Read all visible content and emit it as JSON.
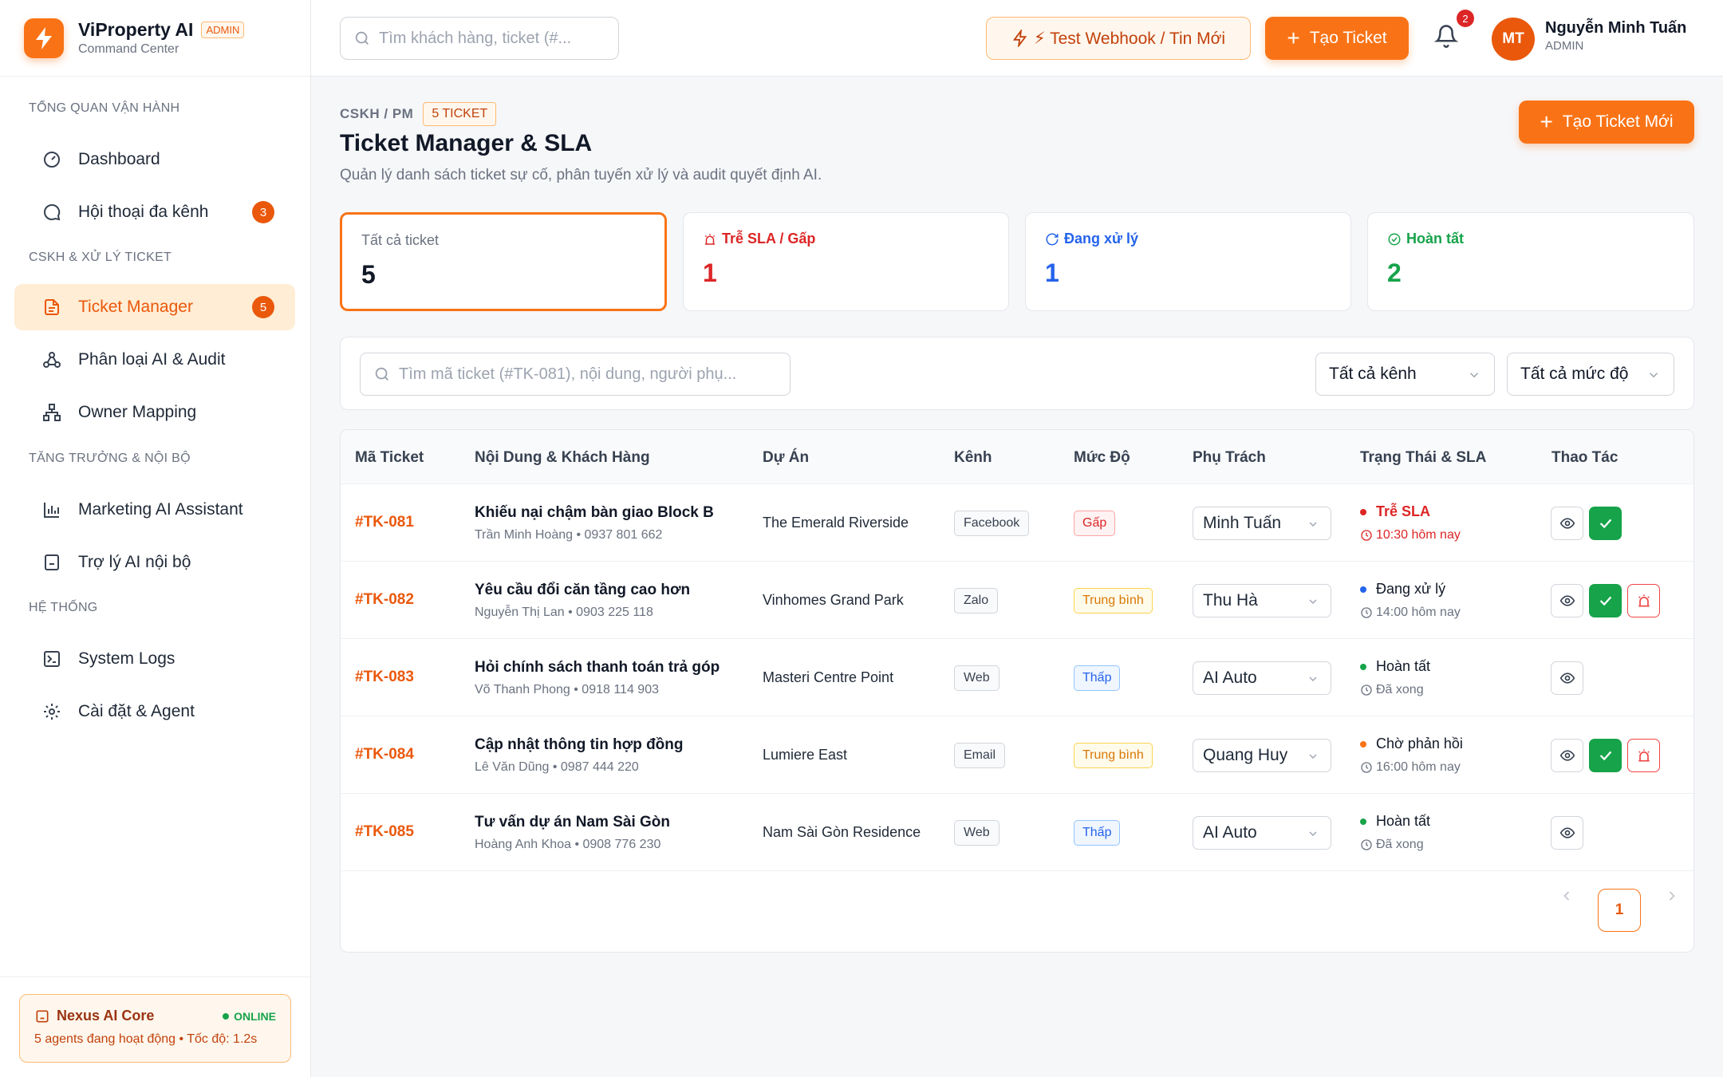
{
  "brand": {
    "title": "ViProperty AI",
    "tag": "ADMIN",
    "subtitle": "Command Center"
  },
  "sidebar": {
    "sections": [
      {
        "label": "TỔNG QUAN VẬN HÀNH"
      },
      {
        "label": "CSKH & XỬ LÝ TICKET"
      },
      {
        "label": "TĂNG TRƯỞNG & NỘI BỘ"
      },
      {
        "label": "HỆ THỐNG"
      }
    ],
    "items": [
      {
        "label": "Dashboard",
        "icon": "gauge-icon"
      },
      {
        "label": "Hội thoại đa kênh",
        "icon": "chat-icon",
        "badge": "3"
      },
      {
        "label": "Ticket Manager",
        "icon": "document-icon",
        "badge": "5",
        "active": true
      },
      {
        "label": "Phân loại AI & Audit",
        "icon": "network-icon"
      },
      {
        "label": "Owner Mapping",
        "icon": "org-chart-icon"
      },
      {
        "label": "Marketing AI Assistant",
        "icon": "bar-chart-icon"
      },
      {
        "label": "Trợ lý AI nội bộ",
        "icon": "bot-icon"
      },
      {
        "label": "System Logs",
        "icon": "terminal-icon"
      },
      {
        "label": "Cài đặt & Agent",
        "icon": "gear-icon"
      }
    ],
    "core": {
      "title": "Nexus AI Core",
      "status": "ONLINE",
      "subtitle": "5 agents đang hoạt động • Tốc độ: 1.2s"
    }
  },
  "topbar": {
    "search_placeholder": "Tìm khách hàng, ticket (#...",
    "webhook_label": "⚡ Test Webhook / Tin Mới",
    "create_label": "Tạo Ticket",
    "notifications": "2",
    "user": {
      "initials": "MT",
      "name": "Nguyễn Minh Tuấn",
      "role": "ADMIN"
    }
  },
  "page": {
    "crumb": "CSKH / PM",
    "count_badge": "5 TICKET",
    "title": "Ticket Manager & SLA",
    "description": "Quản lý danh sách ticket sự cố, phân tuyến xử lý và audit quyết định AI.",
    "new_button": "Tạo Ticket Mới"
  },
  "stats": [
    {
      "label": "Tất cả ticket",
      "value": "5",
      "color": "#111827"
    },
    {
      "label": "Trễ SLA / Gấp",
      "value": "1",
      "color": "#dc2626"
    },
    {
      "label": "Đang xử lý",
      "value": "1",
      "color": "#2563eb"
    },
    {
      "label": "Hoàn tất",
      "value": "2",
      "color": "#16a34a"
    }
  ],
  "filters": {
    "search_placeholder": "Tìm mã ticket (#TK-081), nội dung, người phụ...",
    "channel": "Tất cả kênh",
    "severity": "Tất cả mức độ"
  },
  "table": {
    "columns": [
      "Mã Ticket",
      "Nội Dung & Khách Hàng",
      "Dự Án",
      "Kênh",
      "Mức Độ",
      "Phụ Trách",
      "Trạng Thái & SLA",
      "Thao Tác"
    ],
    "rows": [
      {
        "id": "#TK-081",
        "title": "Khiếu nại chậm bàn giao Block B",
        "customer": "Trần Minh Hoàng • 0937 801 662",
        "project": "The Emerald Riverside",
        "channel": "Facebook",
        "severity": "Gấp",
        "owner": "Minh Tuấn",
        "status": "Trễ SLA",
        "time": "10:30 hôm nay"
      },
      {
        "id": "#TK-082",
        "title": "Yêu cầu đổi căn tầng cao hơn",
        "customer": "Nguyễn Thị Lan • 0903 225 118",
        "project": "Vinhomes Grand Park",
        "channel": "Zalo",
        "severity": "Trung bình",
        "owner": "Thu Hà",
        "status": "Đang xử lý",
        "time": "14:00 hôm nay"
      },
      {
        "id": "#TK-083",
        "title": "Hỏi chính sách thanh toán trả góp",
        "customer": "Võ Thanh Phong • 0918 114 903",
        "project": "Masteri Centre Point",
        "channel": "Web",
        "severity": "Thấp",
        "owner": "AI Auto",
        "status": "Hoàn tất",
        "time": "Đã xong"
      },
      {
        "id": "#TK-084",
        "title": "Cập nhật thông tin hợp đồng",
        "customer": "Lê Văn Dũng • 0987 444 220",
        "project": "Lumiere East",
        "channel": "Email",
        "severity": "Trung bình",
        "owner": "Quang Huy",
        "status": "Chờ phản hồi",
        "time": "16:00 hôm nay"
      },
      {
        "id": "#TK-085",
        "title": "Tư vấn dự án Nam Sài Gòn",
        "customer": "Hoàng Anh Khoa • 0908 776 230",
        "project": "Nam Sài Gòn Residence",
        "channel": "Web",
        "severity": "Thấp",
        "owner": "AI Auto",
        "status": "Hoàn tất",
        "time": "Đã xong"
      }
    ]
  },
  "pagination": {
    "current": "1"
  },
  "colors": {
    "accent": "#f97316",
    "danger": "#dc2626",
    "info": "#2563eb",
    "success": "#16a34a",
    "pending": "#f97316"
  }
}
